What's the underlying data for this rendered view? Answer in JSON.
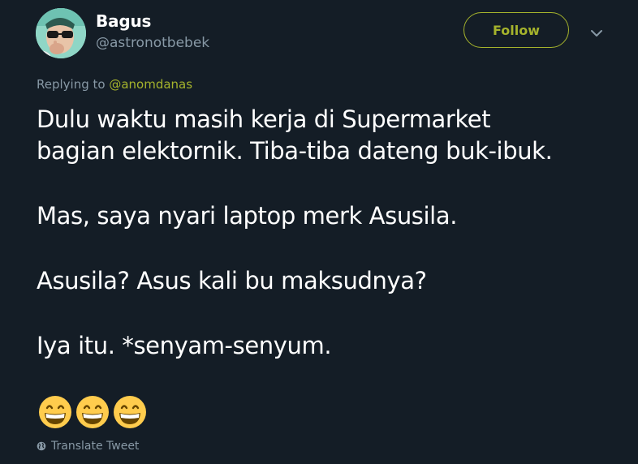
{
  "author": {
    "display_name": "Bagus",
    "username": "@astronotbebek"
  },
  "follow_button": {
    "label": "Follow"
  },
  "reply_context": {
    "prefix": "Replying to ",
    "mention": "@anomdanas"
  },
  "tweet": {
    "paragraphs": [
      [
        "Dulu waktu masih kerja di Supermarket",
        "bagian elektornik. Tiba-tiba dateng buk-ibuk."
      ],
      [
        "Mas, saya nyari laptop merk Asusila."
      ],
      [
        "Asusila? Asus kali bu maksudnya?"
      ],
      [
        "Iya itu. *senyam-senyum."
      ]
    ],
    "emojis": [
      "grinning-face-emoji",
      "grinning-face-emoji",
      "grinning-face-emoji"
    ]
  },
  "translate": {
    "label": "Translate Tweet",
    "icon": "globe-icon"
  },
  "colors": {
    "background": "#141d26",
    "accent": "#a5b32c",
    "muted": "#8899a6",
    "text": "#ffffff"
  }
}
